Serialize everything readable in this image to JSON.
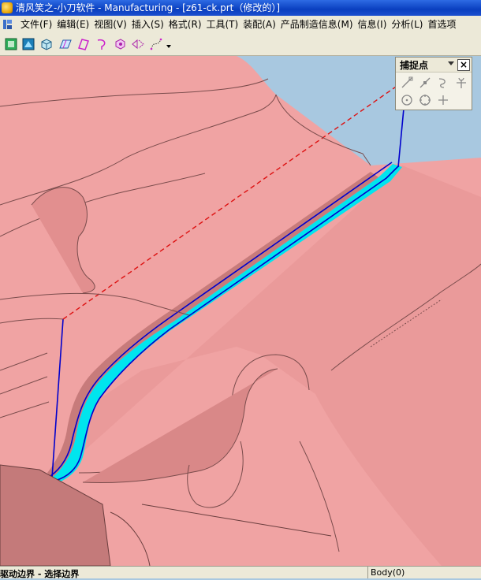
{
  "window": {
    "title": "清风笑之-小刀软件 - Manufacturing - [z61-ck.prt（修改的）]"
  },
  "menu": {
    "items": [
      "文件(F)",
      "编辑(E)",
      "视图(V)",
      "插入(S)",
      "格式(R)",
      "工具(T)",
      "装配(A)",
      "产品制造信息(M)",
      "信息(I)",
      "分析(L)",
      "首选项"
    ]
  },
  "toolbar": {
    "icons": [
      "part-navigator-icon",
      "save-view-icon",
      "solid-body-icon",
      "sheet-body-icon",
      "plane-icon",
      "curve-icon",
      "datum-csys-icon",
      "section-icon",
      "point-set-icon",
      "toolbar-overflow-icon"
    ]
  },
  "snap_panel": {
    "title": "捕捉点",
    "close_label": "×",
    "icons": [
      "endpoint-snap-icon",
      "midpoint-snap-icon",
      "control-point-snap-icon",
      "intersection-snap-icon",
      "arc-center-snap-icon",
      "quadrant-snap-icon",
      "existing-point-snap-icon"
    ]
  },
  "status": {
    "prompt": "驱动边界 - 选择边界",
    "selection": "Body(0)"
  },
  "colors": {
    "model": "#f0a3a3",
    "model_shadow": "#c77b7b",
    "highlight": "#00e5ee",
    "boundary_line": "#0000cc",
    "dashed_line": "#dd1111",
    "background": "#a8c8e0"
  }
}
